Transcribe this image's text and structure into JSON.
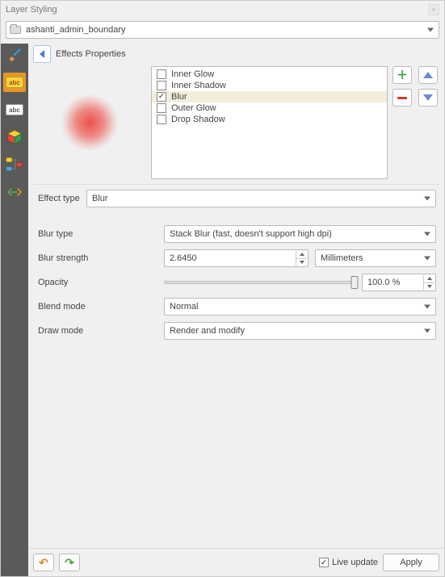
{
  "title": "Layer Styling",
  "layer_selector": {
    "value": "ashanti_admin_boundary"
  },
  "header": {
    "effects_properties": "Effects Properties"
  },
  "sidebar": {
    "items": [
      {
        "name": "symbology",
        "active": false
      },
      {
        "name": "labels-abc-yellow",
        "active": true,
        "text": "abc"
      },
      {
        "name": "labels-abc-white",
        "active": false,
        "text": "abc"
      },
      {
        "name": "3d-view",
        "active": false
      },
      {
        "name": "diagrams",
        "active": false
      },
      {
        "name": "history",
        "active": false
      }
    ]
  },
  "effects": {
    "items": [
      {
        "label": "Inner Glow",
        "checked": false,
        "selected": false
      },
      {
        "label": "Inner Shadow",
        "checked": false,
        "selected": false
      },
      {
        "label": "Blur",
        "checked": true,
        "selected": true
      },
      {
        "label": "Outer Glow",
        "checked": false,
        "selected": false
      },
      {
        "label": "Drop Shadow",
        "checked": false,
        "selected": false
      }
    ]
  },
  "form": {
    "effect_type_label": "Effect type",
    "effect_type_value": "Blur",
    "blur_type_label": "Blur type",
    "blur_type_value": "Stack Blur (fast, doesn't support high dpi)",
    "blur_strength_label": "Blur strength",
    "blur_strength_value": "2.6450",
    "blur_strength_unit": "Millimeters",
    "opacity_label": "Opacity",
    "opacity_value": "100.0 %",
    "opacity_slider_pct": 100,
    "blend_mode_label": "Blend mode",
    "blend_mode_value": "Normal",
    "draw_mode_label": "Draw mode",
    "draw_mode_value": "Render and modify"
  },
  "footer": {
    "live_update_label": "Live update",
    "live_update_checked": true,
    "apply_label": "Apply"
  }
}
